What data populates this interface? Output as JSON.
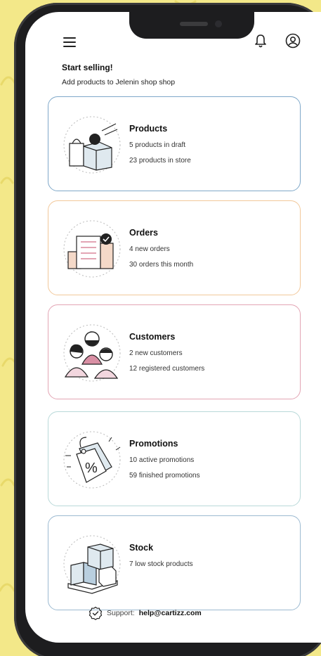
{
  "topbar": {
    "menu_icon": "hamburger-menu-icon",
    "bell_icon": "bell-icon",
    "user_icon": "user-circle-icon"
  },
  "header": {
    "title": "Start selling!",
    "subtitle": "Add products to Jelenin shop shop"
  },
  "cards": [
    {
      "title": "Products",
      "line1": "5 products in draft",
      "line2": "23 products in store",
      "border": "#7fa8c9"
    },
    {
      "title": "Orders",
      "line1": "4 new orders",
      "line2": "30 orders this month",
      "border": "#f2c89a"
    },
    {
      "title": "Customers",
      "line1": "2 new customers",
      "line2": "12 registered customers",
      "border": "#e3a5b4"
    },
    {
      "title": "Promotions",
      "line1": "10 active promotions",
      "line2": "59 finished promotions",
      "border": "#b9d9d9"
    },
    {
      "title": "Stock",
      "line1": "7 low stock products",
      "border": "#9cbad1"
    }
  ],
  "footer": {
    "support_label": "Support:",
    "support_email": "help@cartizz.com",
    "support_icon": "check-badge-icon"
  },
  "colors": {
    "background": "#f3e889",
    "accent_pink": "#e3a5b4",
    "accent_blue": "#7fa8c9"
  }
}
